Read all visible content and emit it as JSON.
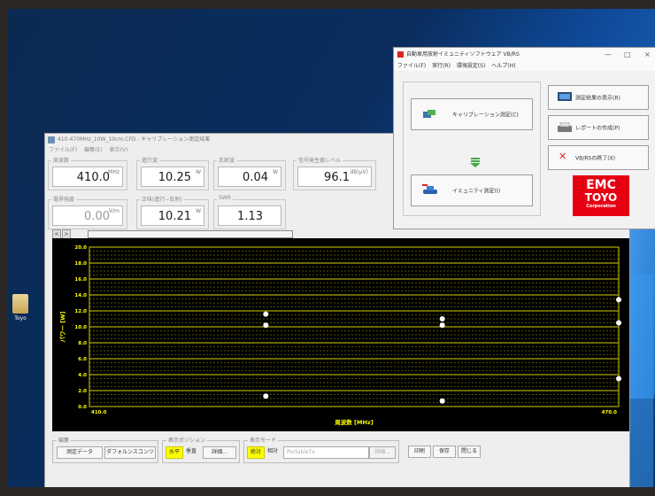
{
  "desktop": {
    "icon_label": "Toyo"
  },
  "measurement_window": {
    "title": "410-470MHz_10W_10cm.CFD - キャリブレーション測定結果",
    "menu": [
      "ファイル(F)",
      "編集(E)",
      "表示(V)"
    ],
    "fields": {
      "frequency": {
        "caption": "周波数",
        "value": "410.0",
        "unit": "MHz"
      },
      "forward": {
        "caption": "進行波",
        "value": "10.25",
        "unit": "W"
      },
      "reflected": {
        "caption": "反射波",
        "value": "0.04",
        "unit": "W"
      },
      "siggen": {
        "caption": "信号発生器レベル",
        "value": "96.1",
        "unit": "dB(μV)"
      },
      "field_strength": {
        "caption": "電界強度",
        "value": "0.00",
        "unit": "V/m"
      },
      "net": {
        "caption": "正味(進行−反射)",
        "value": "10.21",
        "unit": "W"
      },
      "swr": {
        "caption": "SWR",
        "value": "1.13"
      }
    },
    "scroll_buttons": [
      "<",
      ">"
    ],
    "bottom": {
      "edit_group": {
        "caption": "編集",
        "buttons": [
          "測定データ",
          "ダフォルンスコンツ"
        ]
      },
      "display_group": {
        "caption": "表示ポジション",
        "horizontal": "水平",
        "vertical": "垂直",
        "detail": "詳細..."
      },
      "mode_group": {
        "caption": "表示モード",
        "absolute": "絶対",
        "relative": "相対",
        "combo": "PortableTx",
        "detail": "詳細..."
      },
      "buttons": {
        "print": "印刷",
        "save": "保存",
        "close": "閉じる"
      }
    }
  },
  "chart_data": {
    "type": "scatter",
    "ylabel": "パワー [W]",
    "xlabel": "周波数 [MHz]",
    "x_tick_labels": [
      "410.0",
      "470.0"
    ],
    "y_tick_labels": [
      "20.0",
      "18.0",
      "16.0",
      "14.0",
      "12.0",
      "10.0",
      "8.0",
      "6.0",
      "4.0",
      "2.0",
      "0.0"
    ],
    "xlim": [
      410,
      470
    ],
    "ylim": [
      0,
      20
    ],
    "grid": true,
    "points": [
      {
        "x": 430,
        "y": 11.6
      },
      {
        "x": 430,
        "y": 10.2
      },
      {
        "x": 430,
        "y": 1.3
      },
      {
        "x": 450,
        "y": 11.0
      },
      {
        "x": 450,
        "y": 10.2
      },
      {
        "x": 450,
        "y": 0.7
      },
      {
        "x": 470,
        "y": 13.4
      },
      {
        "x": 470,
        "y": 10.5
      },
      {
        "x": 470,
        "y": 3.5
      }
    ],
    "colors": {
      "background": "#000000",
      "grid": "#d8d000",
      "points": "#ffffff",
      "labels": "#ffff00"
    }
  },
  "immunity_window": {
    "title": "自動車用放射イミュニティソフトウェア VB/RS",
    "window_controls": [
      "—",
      "□",
      "×"
    ],
    "menu": [
      "ファイル(F)",
      "実行(R)",
      "環境設定(S)",
      "ヘルプ(H)"
    ],
    "calibration_button": "キャリブレーション測定(C)",
    "immunity_button": "イミュニティ測定(I)",
    "show_results_button": "測定結果の表示(R)",
    "report_button": "レポートの作成(P)",
    "exit_button": "VB/RSの終了(X)",
    "logo": {
      "line1": "EMC",
      "line2": "TOYO",
      "line3": "Corporation"
    }
  }
}
